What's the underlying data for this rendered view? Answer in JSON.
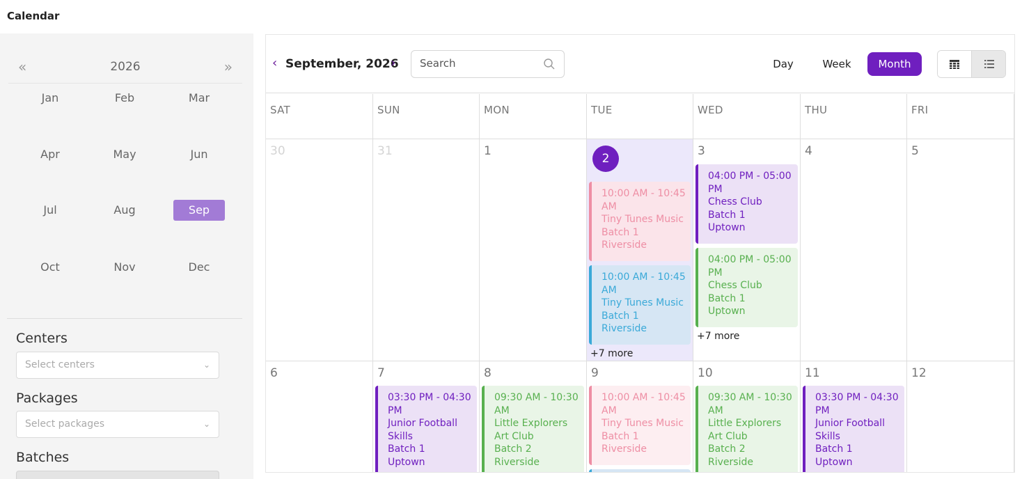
{
  "page": {
    "title": "Calendar"
  },
  "sidebar": {
    "year": "2026",
    "prev_year": "«",
    "next_year": "»",
    "months": [
      "Jan",
      "Feb",
      "Mar",
      "Apr",
      "May",
      "Jun",
      "Jul",
      "Aug",
      "Sep",
      "Oct",
      "Nov",
      "Dec"
    ],
    "selected_month": "Sep",
    "filters": {
      "centers": {
        "label": "Centers",
        "placeholder": "Select centers"
      },
      "packages": {
        "label": "Packages",
        "placeholder": "Select packages"
      },
      "batches": {
        "label": "Batches"
      }
    }
  },
  "toolbar": {
    "prev": "‹",
    "next": "›",
    "month_title": "September, 2026",
    "search_placeholder": "Search",
    "views": {
      "day": "Day",
      "week": "Week",
      "month": "Month"
    },
    "active_view": "Month"
  },
  "calendar": {
    "weekdays": [
      "SAT",
      "SUN",
      "MON",
      "TUE",
      "WED",
      "THU",
      "FRI"
    ],
    "week1": [
      "30",
      "31",
      "1",
      "2",
      "3",
      "4",
      "5"
    ],
    "week2": [
      "6",
      "7",
      "8",
      "9",
      "10",
      "11",
      "12"
    ],
    "more": {
      "tue_2": "+7 more",
      "wed_3": "+7 more"
    },
    "events": {
      "tue2_a": {
        "time1": "10:00 AM - 10:45",
        "time2": "AM",
        "name": "Tiny Tunes Music",
        "batch": "Batch 1",
        "center": "Riverside"
      },
      "tue2_b": {
        "time1": "10:00 AM - 10:45",
        "time2": "AM",
        "name": "Tiny Tunes Music",
        "batch": "Batch 1",
        "center": "Riverside"
      },
      "wed3_a": {
        "time1": "04:00 PM - 05:00",
        "time2": "PM",
        "name": "Chess Club",
        "batch": "Batch 1",
        "center": "Uptown"
      },
      "wed3_b": {
        "time1": "04:00 PM - 05:00",
        "time2": "PM",
        "name": "Chess Club",
        "batch": "Batch 1",
        "center": "Uptown"
      },
      "sun7": {
        "time1": "03:30 PM - 04:30",
        "time2": "PM",
        "name": "Junior Football",
        "name2": "Skills",
        "batch": "Batch 1",
        "center": "Uptown"
      },
      "mon8": {
        "time1": "09:30 AM - 10:30",
        "time2": "AM",
        "name": "Little Explorers",
        "name2": "Art Club",
        "batch": "Batch 2",
        "center": "Riverside"
      },
      "tue9": {
        "time1": "10:00 AM - 10:45",
        "time2": "AM",
        "name": "Tiny Tunes Music",
        "batch": "Batch 1",
        "center": "Riverside"
      },
      "wed10": {
        "time1": "09:30 AM - 10:30",
        "time2": "AM",
        "name": "Little Explorers",
        "name2": "Art Club",
        "batch": "Batch 2",
        "center": "Riverside"
      },
      "thu11": {
        "time1": "03:30 PM - 04:30",
        "time2": "PM",
        "name": "Junior Football",
        "name2": "Skills",
        "batch": "Batch 1",
        "center": "Uptown"
      }
    }
  },
  "colors": {
    "accent": "#6f1fbf",
    "selected_month": "#a27bd6",
    "today_bg": "#ece8fb",
    "event_purple": "#6f1fbf",
    "event_green": "#58b04f",
    "event_pink": "#ee8ea4",
    "event_blue": "#3aa9d8"
  },
  "icons": {
    "search": "search-icon",
    "grid_view": "calendar-grid-icon",
    "list_view": "list-icon",
    "dropdown": "chevron-down-icon"
  }
}
